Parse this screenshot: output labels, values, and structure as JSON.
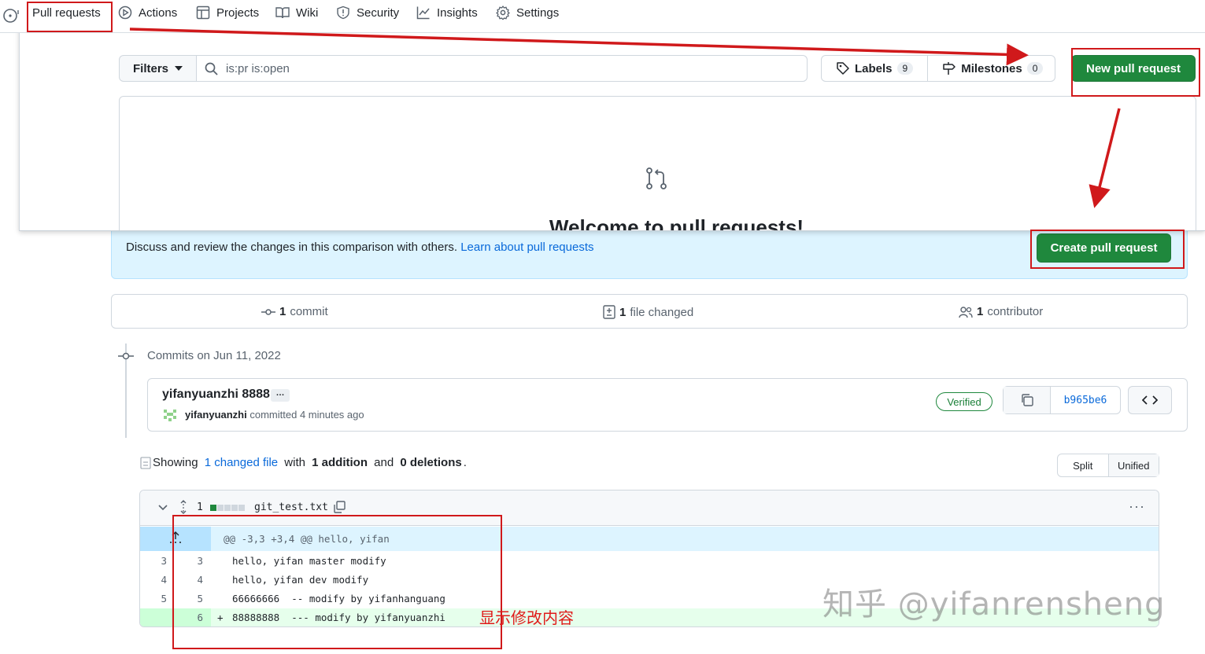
{
  "tabs": [
    {
      "label": "Pull requests",
      "icon": "git-pull-request-icon"
    },
    {
      "label": "Actions",
      "icon": "play-icon"
    },
    {
      "label": "Projects",
      "icon": "table-icon"
    },
    {
      "label": "Wiki",
      "icon": "book-icon"
    },
    {
      "label": "Security",
      "icon": "shield-icon"
    },
    {
      "label": "Insights",
      "icon": "graph-icon"
    },
    {
      "label": "Settings",
      "icon": "gear-icon"
    }
  ],
  "pr_list": {
    "filters_label": "Filters",
    "search_value": "is:pr is:open",
    "labels_label": "Labels",
    "labels_count": "9",
    "milestones_label": "Milestones",
    "milestones_count": "0",
    "new_pr_label": "New pull request",
    "welcome_title": "Welcome to pull requests!"
  },
  "compare": {
    "flash_text": "Discuss and review the changes in this comparison with others.",
    "flash_link": "Learn about pull requests",
    "create_pr_label": "Create pull request",
    "summary": {
      "commits_count": "1",
      "commits_label": "commit",
      "files_count": "1",
      "files_label": "file changed",
      "contributors_count": "1",
      "contributors_label": "contributor"
    },
    "commits_date": "Commits on Jun 11, 2022",
    "commit": {
      "title": "yifanyuanzhi 8888",
      "ellipsis": "…",
      "author": "yifanyuanzhi",
      "meta": "committed 4 minutes ago",
      "verified": "Verified",
      "sha": "b965be6"
    },
    "diff_stats": {
      "showing": "Showing",
      "changed_file": "1 changed file",
      "with": "with",
      "additions": "1 addition",
      "and": "and",
      "deletions": "0 deletions",
      "period": "."
    },
    "view_split": "Split",
    "view_unified": "Unified",
    "file": {
      "count": "1",
      "name": "git_test.txt",
      "hunk": "@@ -3,3 +3,4 @@ hello, yifan",
      "lines": [
        {
          "old": "3",
          "new": "3",
          "sign": " ",
          "text": "hello, yifan master modify",
          "added": false
        },
        {
          "old": "4",
          "new": "4",
          "sign": " ",
          "text": "hello, yifan dev modify",
          "added": false
        },
        {
          "old": "5",
          "new": "5",
          "sign": " ",
          "text": "66666666  -- modify by yifanhanguang",
          "added": false
        },
        {
          "old": "",
          "new": "6",
          "sign": "+",
          "text": "88888888  --- modify by yifanyuanzhi",
          "added": true
        }
      ]
    }
  },
  "annotation_text": "显示修改内容",
  "watermark": "知乎 @yifanrensheng",
  "colors": {
    "accent_green": "#1f883d",
    "annotation_red": "#d0191b",
    "link_blue": "#0969da"
  }
}
